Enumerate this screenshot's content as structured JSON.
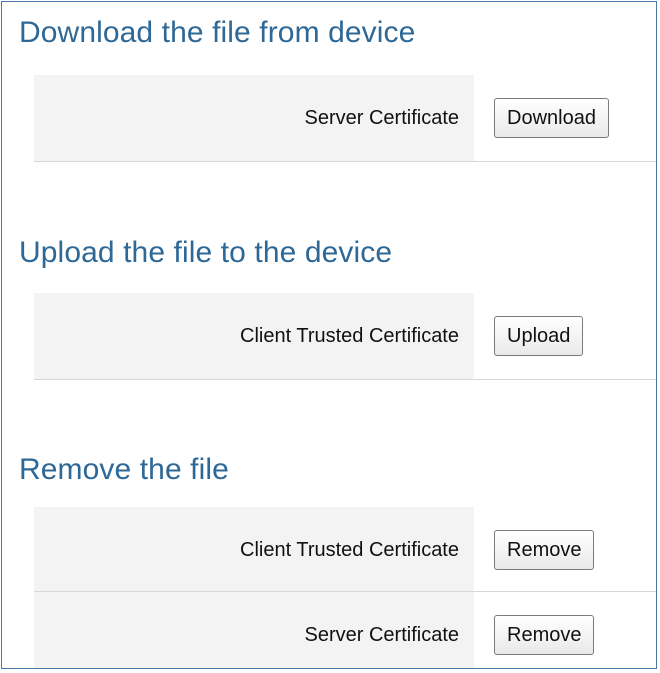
{
  "sections": {
    "download": {
      "title": "Download the file from device",
      "rows": [
        {
          "label": "Server Certificate",
          "button": "Download"
        }
      ]
    },
    "upload": {
      "title": "Upload the file to the device",
      "rows": [
        {
          "label": "Client Trusted Certificate",
          "button": "Upload"
        }
      ]
    },
    "remove": {
      "title": "Remove the file",
      "rows": [
        {
          "label": "Client Trusted Certificate",
          "button": "Remove"
        },
        {
          "label": "Server Certificate",
          "button": "Remove"
        }
      ]
    }
  }
}
